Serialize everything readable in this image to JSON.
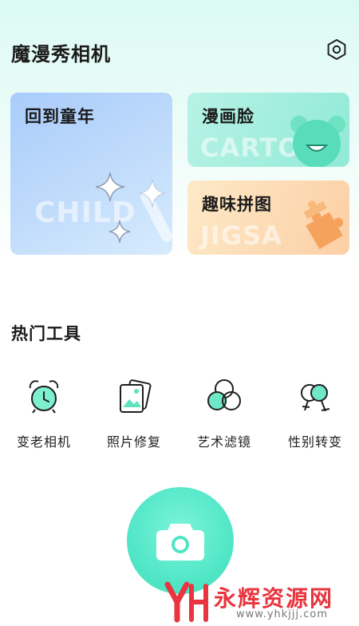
{
  "app": {
    "title": "魔漫秀相机"
  },
  "header": {
    "settings_icon": "gear-icon"
  },
  "cards": {
    "childhood": {
      "title": "回到童年",
      "watermark": "CHILD",
      "icon": "sparkle-wand-icon",
      "color": "#a9ccfb"
    },
    "cartoon": {
      "title": "漫画脸",
      "watermark": "CARTO",
      "icon": "cartoon-bear-icon",
      "color": "#92ead7"
    },
    "puzzle": {
      "title": "趣味拼图",
      "watermark": "JIGSA",
      "icon": "puzzle-piece-icon",
      "color": "#fccfa6"
    }
  },
  "hot_tools": {
    "title": "热门工具",
    "items": [
      {
        "label": "变老相机",
        "icon": "alarm-clock-icon"
      },
      {
        "label": "照片修复",
        "icon": "photo-stack-icon"
      },
      {
        "label": "艺术滤镜",
        "icon": "color-circles-icon"
      },
      {
        "label": "性别转变",
        "icon": "gender-symbols-icon"
      }
    ]
  },
  "camera": {
    "icon": "camera-icon",
    "color": "#4fe6c6"
  },
  "watermark": {
    "text": "永辉资源网",
    "url": "www.yhkjjj.com",
    "color": "#e8353f"
  }
}
